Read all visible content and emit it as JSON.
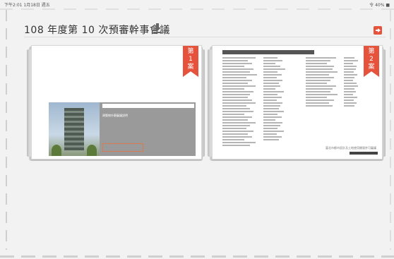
{
  "status_bar": {
    "left": "下午2:01 1月18日 週五",
    "right": "令 40% ■"
  },
  "header": {
    "title": "108 年度第 10 次預審幹事會議"
  },
  "books": [
    {
      "ribbon": [
        "第",
        "1",
        "案"
      ],
      "cover_caption": "建築物外觀審議說明"
    },
    {
      "ribbon": [
        "第",
        "2",
        "案"
      ],
      "footer_text": "臺北市都市設計及土地使用開發許可審議"
    }
  ],
  "colors": {
    "ribbon": "#e5533d",
    "exit_icon": "#e5533d",
    "cover_band": "#9a9a9a",
    "background": "#f2f2f2"
  },
  "icons": {
    "download": "download-icon",
    "exit": "exit-icon"
  }
}
